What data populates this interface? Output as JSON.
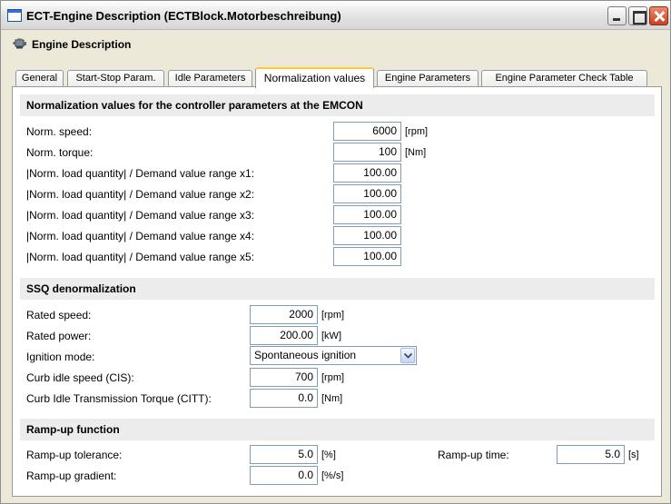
{
  "window": {
    "title": "ECT-Engine Description (ECTBlock.Motorbeschreibung)"
  },
  "header": {
    "title": "Engine Description",
    "icon": "engine-icon"
  },
  "tabs": [
    {
      "label": "General",
      "active": false
    },
    {
      "label": "Start-Stop Param.",
      "active": false
    },
    {
      "label": "Idle Parameters",
      "active": false
    },
    {
      "label": "Normalization values",
      "active": true
    },
    {
      "label": "Engine Parameters",
      "active": false
    },
    {
      "label": "Engine Parameter Check Table",
      "active": false
    }
  ],
  "normalization": {
    "title": "Normalization values for the controller parameters at the EMCON",
    "rows": [
      {
        "label": "Norm. speed:",
        "value": "6000",
        "unit": "[rpm]"
      },
      {
        "label": "Norm. torque:",
        "value": "100",
        "unit": "[Nm]"
      },
      {
        "label": "|Norm. load quantity| / Demand value range x1:",
        "value": "100.00",
        "unit": ""
      },
      {
        "label": "|Norm. load quantity| / Demand value range x2:",
        "value": "100.00",
        "unit": ""
      },
      {
        "label": "|Norm. load quantity| / Demand value range x3:",
        "value": "100.00",
        "unit": ""
      },
      {
        "label": "|Norm. load quantity| / Demand value range x4:",
        "value": "100.00",
        "unit": ""
      },
      {
        "label": "|Norm. load quantity| / Demand value range x5:",
        "value": "100.00",
        "unit": ""
      }
    ]
  },
  "ssq": {
    "title": "SSQ denormalization",
    "rated_speed": {
      "label": "Rated speed:",
      "value": "2000",
      "unit": "[rpm]"
    },
    "rated_power": {
      "label": "Rated power:",
      "value": "200.00",
      "unit": "[kW]"
    },
    "ignition_mode": {
      "label": "Ignition mode:",
      "value": "Spontaneous ignition"
    },
    "curb_idle_speed": {
      "label": "Curb idle speed (CIS):",
      "value": "700",
      "unit": "[rpm]"
    },
    "curb_idle_torque": {
      "label": "Curb Idle Transmission Torque (CITT):",
      "value": "0.0",
      "unit": "[Nm]"
    }
  },
  "rampup": {
    "title": "Ramp-up function",
    "tolerance": {
      "label": "Ramp-up tolerance:",
      "value": "5.0",
      "unit": "[%]"
    },
    "gradient": {
      "label": "Ramp-up gradient:",
      "value": "0.0",
      "unit": "[%/s]"
    },
    "time": {
      "label": "Ramp-up time:",
      "value": "5.0",
      "unit": "[s]"
    }
  },
  "colors": {
    "tab_highlight": "#ffc83c",
    "section_background": "#ececec",
    "input_border": "#7f9db9",
    "close_button": "#c7411f"
  }
}
